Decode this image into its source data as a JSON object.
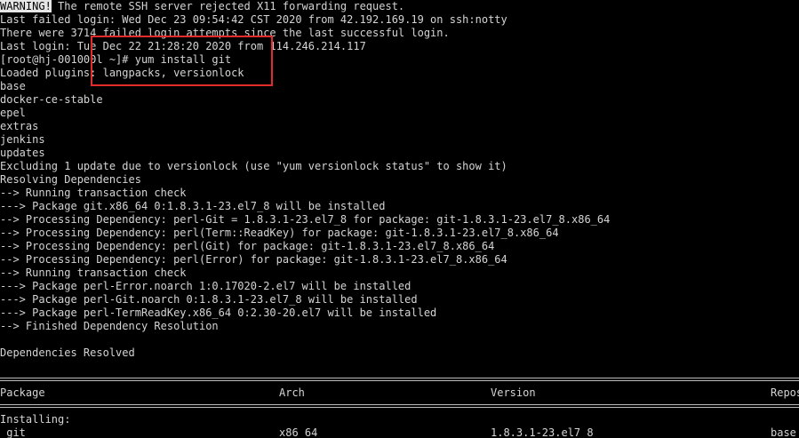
{
  "terminal": {
    "warning_tag": "WARNING!",
    "warning_rest": " The remote SSH server rejected X11 forwarding request.",
    "lines_top": [
      "Last failed login: Wed Dec 23 09:54:42 CST 2020 from 42.192.169.19 on ssh:notty",
      "There were 3714 failed login attempts since the last successful login.",
      "Last login: Tue Dec 22 21:28:20 2020 from 114.246.214.117",
      "[root@hj-001000l ~]# yum install git",
      "Loaded plugins: langpacks, versionlock",
      "base",
      "docker-ce-stable",
      "epel",
      "extras",
      "jenkins",
      "updates",
      "Excluding 1 update due to versionlock (use \"yum versionlock status\" to show it)",
      "Resolving Dependencies",
      "--> Running transaction check",
      "---> Package git.x86_64 0:1.8.3.1-23.el7_8 will be installed",
      "--> Processing Dependency: perl-Git = 1.8.3.1-23.el7_8 for package: git-1.8.3.1-23.el7_8.x86_64",
      "--> Processing Dependency: perl(Term::ReadKey) for package: git-1.8.3.1-23.el7_8.x86_64",
      "--> Processing Dependency: perl(Git) for package: git-1.8.3.1-23.el7_8.x86_64",
      "--> Processing Dependency: perl(Error) for package: git-1.8.3.1-23.el7_8.x86_64",
      "--> Running transaction check",
      "---> Package perl-Error.noarch 1:0.17020-2.el7 will be installed",
      "---> Package perl-Git.noarch 0:1.8.3.1-23.el7_8 will be installed",
      "---> Package perl-TermReadKey.x86_64 0:2.30-20.el7 will be installed",
      "--> Finished Dependency Resolution",
      "",
      "Dependencies Resolved"
    ],
    "table": {
      "headers": [
        "Package",
        "Arch",
        "Version",
        "Repos"
      ],
      "section_label": "Installing:",
      "rows": [
        [
          " git",
          "x86_64",
          "1.8.3.1-23.el7_8",
          "base"
        ]
      ]
    },
    "highlight_color": "#e22b2b"
  }
}
